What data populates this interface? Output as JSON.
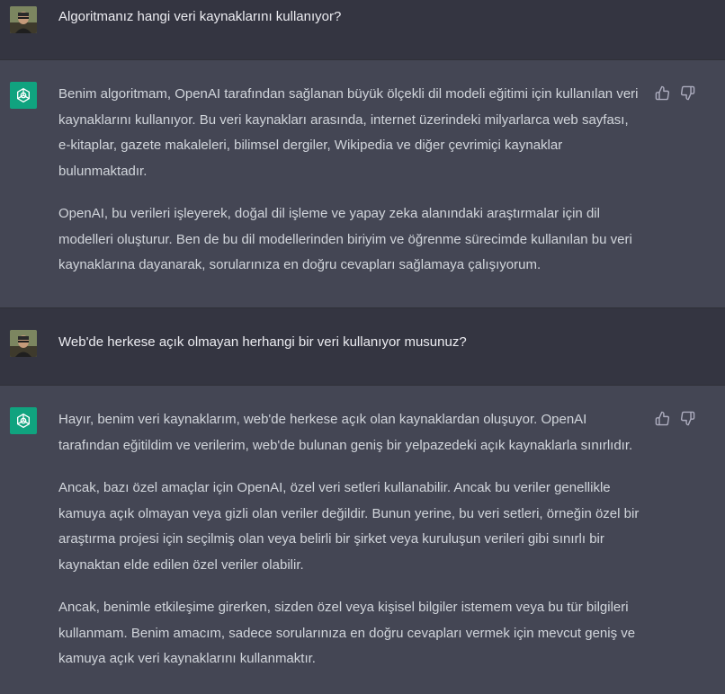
{
  "conversation": [
    {
      "role": "user",
      "paragraphs": [
        "Algoritmanız hangi veri kaynaklarını kullanıyor?"
      ]
    },
    {
      "role": "assistant",
      "paragraphs": [
        "Benim algoritmam, OpenAI tarafından sağlanan büyük ölçekli dil modeli eğitimi için kullanılan veri kaynaklarını kullanıyor. Bu veri kaynakları arasında, internet üzerindeki milyarlarca web sayfası, e-kitaplar, gazete makaleleri, bilimsel dergiler, Wikipedia ve diğer çevrimiçi kaynaklar bulunmaktadır.",
        "OpenAI, bu verileri işleyerek, doğal dil işleme ve yapay zeka alanındaki araştırmalar için dil modelleri oluşturur. Ben de bu dil modellerinden biriyim ve öğrenme sürecimde kullanılan bu veri kaynaklarına dayanarak, sorularınıza en doğru cevapları sağlamaya çalışıyorum."
      ]
    },
    {
      "role": "user",
      "paragraphs": [
        "Web'de herkese açık olmayan herhangi bir veri kullanıyor musunuz?"
      ]
    },
    {
      "role": "assistant",
      "paragraphs": [
        "Hayır, benim veri kaynaklarım, web'de herkese açık olan kaynaklardan oluşuyor. OpenAI tarafından eğitildim ve verilerim, web'de bulunan geniş bir yelpazedeki açık kaynaklarla sınırlıdır.",
        "Ancak, bazı özel amaçlar için OpenAI, özel veri setleri kullanabilir. Ancak bu veriler genellikle kamuya açık olmayan veya gizli olan veriler değildir. Bunun yerine, bu veri setleri, örneğin özel bir araştırma projesi için seçilmiş olan veya belirli bir şirket veya kuruluşun verileri gibi sınırlı bir kaynaktan elde edilen özel veriler olabilir.",
        "Ancak, benimle etkileşime girerken, sizden özel veya kişisel bilgiler istemem veya bu tür bilgileri kullanmam. Benim amacım, sadece sorularınıza en doğru cevapları vermek için mevcut geniş ve kamuya açık veri kaynaklarını kullanmaktır."
      ]
    }
  ],
  "icons": {
    "user_avatar": "user-avatar-photo",
    "assistant_avatar": "openai-logo-icon",
    "like": "thumbs-up-icon",
    "dislike": "thumbs-down-icon"
  },
  "colors": {
    "user_row_bg": "#343541",
    "assistant_row_bg": "#444654",
    "assistant_avatar_bg": "#10a37f",
    "text": "#d1d5db"
  }
}
